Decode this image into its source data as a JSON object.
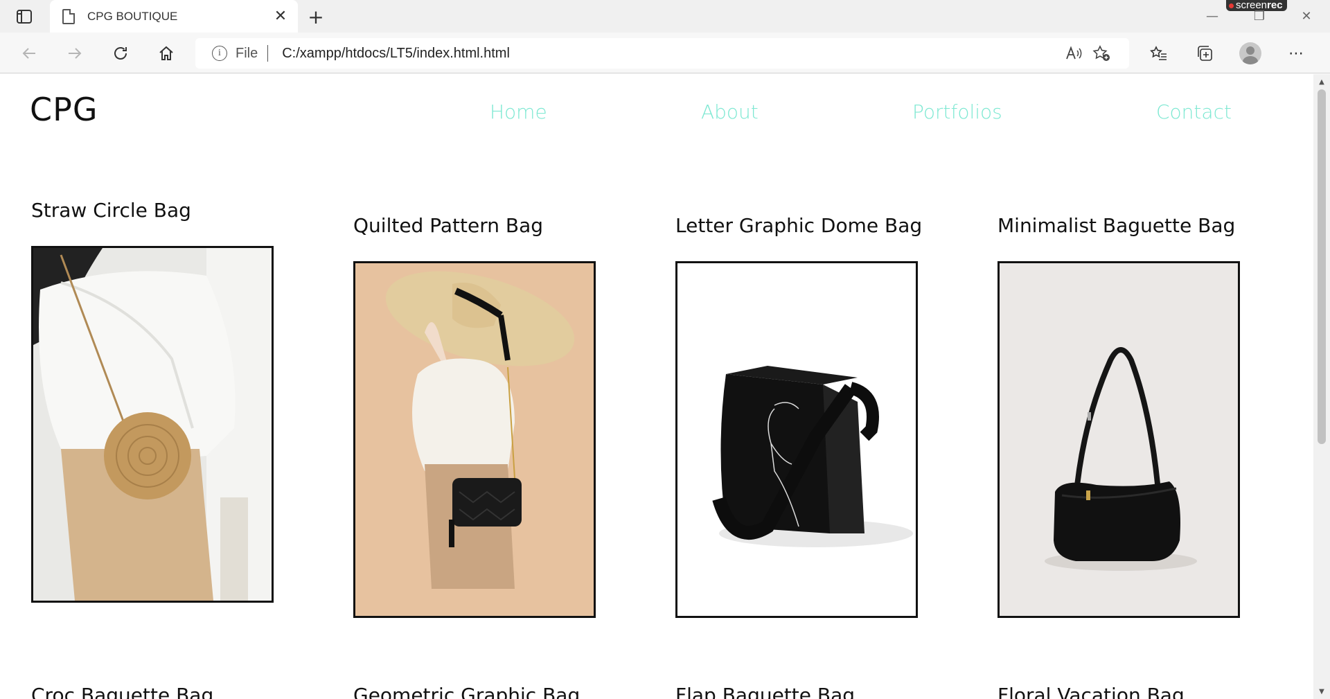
{
  "browser": {
    "tab_title": "CPG BOUTIQUE",
    "address_scheme": "File",
    "address_url": "C:/xampp/htdocs/LT5/index.html.html",
    "recorder_badge_prefix": "screen",
    "recorder_badge_suffix": "rec"
  },
  "site": {
    "logo": "CPG",
    "nav": [
      "Home",
      "About",
      "Portfolios",
      "Contact"
    ],
    "accent_color": "#7de8d2"
  },
  "products": [
    {
      "title": "Straw Circle Bag",
      "image": "woman-with-round-straw-bag"
    },
    {
      "title": "Quilted Pattern Bag",
      "image": "woman-in-sun-hat-with-black-quilted-bag"
    },
    {
      "title": "Letter Graphic Dome Bag",
      "image": "black-tote-with-line-art-face"
    },
    {
      "title": "Minimalist Baguette Bag",
      "image": "black-baguette-shoulder-bag"
    }
  ],
  "products_row2": [
    {
      "title": "Croc Baguette Bag"
    },
    {
      "title": "Geometric Graphic Bag"
    },
    {
      "title": "Flap Baguette Bag"
    },
    {
      "title": "Floral Vacation Bag"
    }
  ]
}
